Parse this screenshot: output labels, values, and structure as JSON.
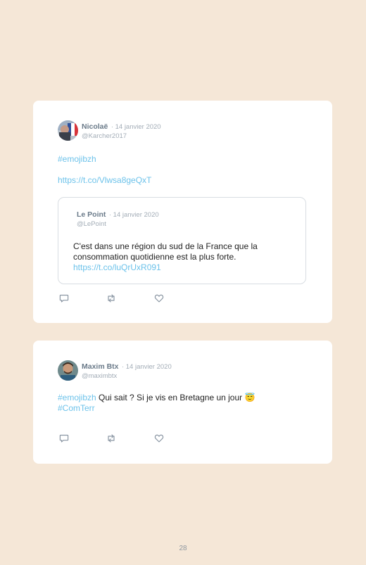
{
  "tweets": [
    {
      "author_name": "Nicolaë",
      "date": "· 14 janvier 2020",
      "handle": "@Karcher2017",
      "text_line1": "#emojibzh",
      "text_line2": "https://t.co/Vlwsa8geQxT",
      "quote": {
        "author_name": "Le Point",
        "date": "· 14 janvier 2020",
        "handle": "@LePoint",
        "text": "C'est dans une région du sud de la France que la consommation quotidienne est la plus forte.",
        "link": "https://t.co/luQrUxR091"
      }
    },
    {
      "author_name": "Maxim Btx",
      "date": "· 14 janvier 2020",
      "handle": "@maximbtx",
      "hashtag1": "#emojibzh",
      "text": " Qui sait ? Si je vis en Bretagne un jour ",
      "emoji": "😇",
      "hashtag2": "#ComTerr"
    }
  ],
  "icons": [
    "reply-icon",
    "retweet-icon",
    "like-icon"
  ],
  "colors": {
    "background": "#f5e7d7",
    "link": "#6cc2ea",
    "icon": "#8a96a3"
  },
  "page_number": "28"
}
